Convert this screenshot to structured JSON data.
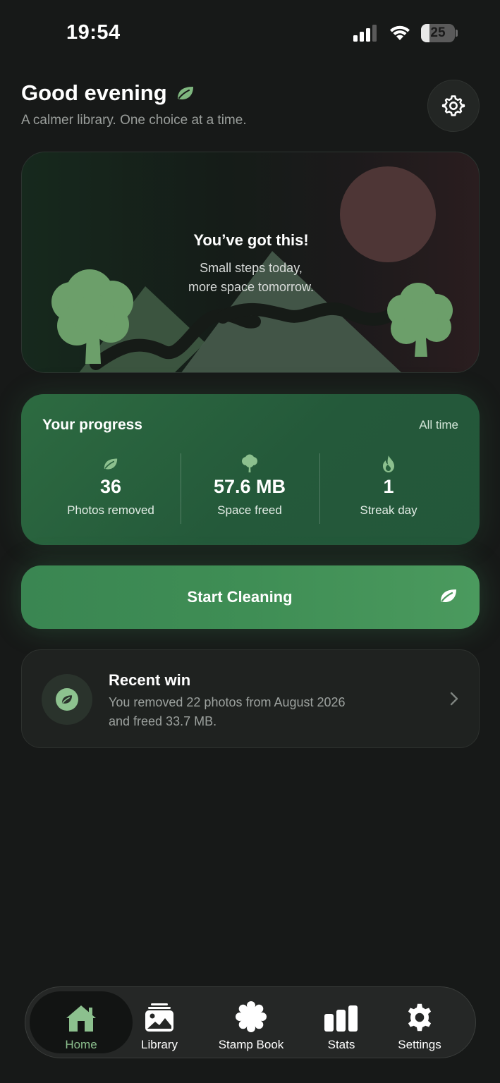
{
  "status_bar": {
    "time": "19:54",
    "battery_level": "25",
    "battery_fraction": 0.25
  },
  "header": {
    "greeting": "Good evening",
    "subtitle": "A calmer library. One choice at a time."
  },
  "hero": {
    "title": "You’ve got this!",
    "line1": "Small steps today,",
    "line2": "more space tomorrow."
  },
  "progress": {
    "title": "Your progress",
    "range": "All time",
    "stats": [
      {
        "value": "36",
        "label": "Photos removed",
        "icon": "leaf-icon"
      },
      {
        "value": "57.6 MB",
        "label": "Space freed",
        "icon": "tree-icon"
      },
      {
        "value": "1",
        "label": "Streak day",
        "icon": "flame-icon"
      }
    ]
  },
  "cta": {
    "label": "Start Cleaning",
    "icon": "leaf-icon"
  },
  "recent_win": {
    "title": "Recent win",
    "line1": "You removed 22 photos from August 2026",
    "line2": "and freed 33.7 MB."
  },
  "tabbar": {
    "active": "Home",
    "items": [
      {
        "label": "Home",
        "icon": "home-icon"
      },
      {
        "label": "Library",
        "icon": "library-icon"
      },
      {
        "label": "Stamp Book",
        "icon": "stamp-icon"
      },
      {
        "label": "Stats",
        "icon": "stats-icon"
      },
      {
        "label": "Settings",
        "icon": "gear-icon"
      }
    ]
  },
  "colors": {
    "background": "#171918",
    "accent_green": "#3f8e55",
    "light_green": "#8cc08e",
    "progress_card": "#28603d"
  }
}
